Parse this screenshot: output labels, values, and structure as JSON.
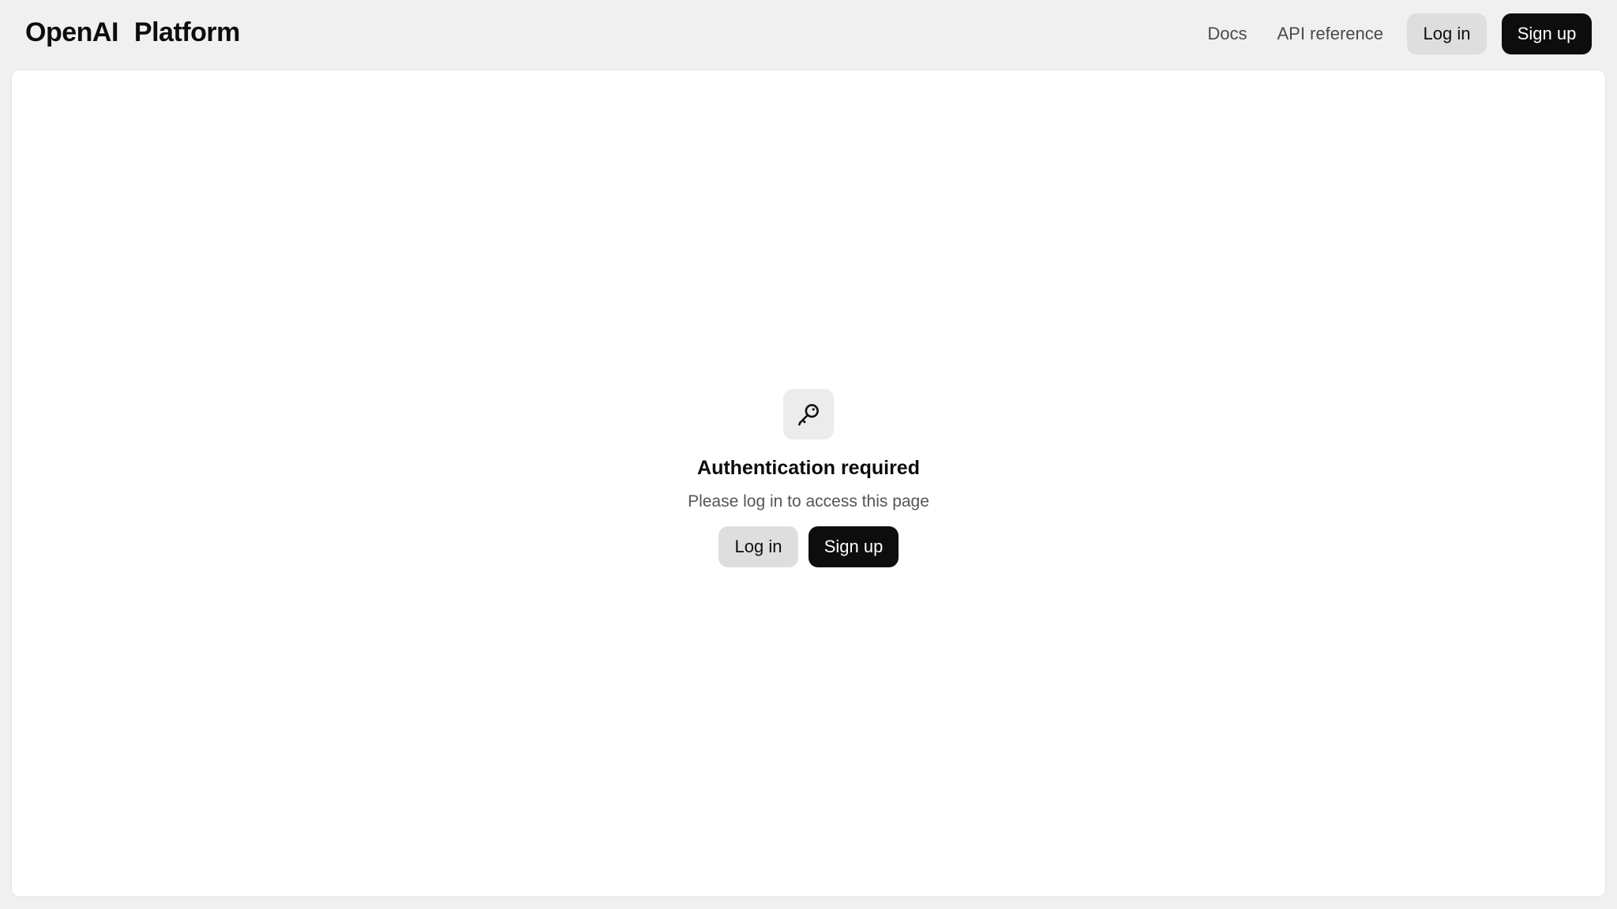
{
  "header": {
    "brand_primary": "OpenAI",
    "brand_secondary": "Platform",
    "nav": {
      "docs": "Docs",
      "api_reference": "API reference"
    },
    "login_label": "Log in",
    "signup_label": "Sign up"
  },
  "main": {
    "icon": "key-icon",
    "title": "Authentication required",
    "subtitle": "Please log in to access this page",
    "login_label": "Log in",
    "signup_label": "Sign up"
  },
  "colors": {
    "background": "#f0f0f0",
    "card": "#ffffff",
    "primary_button": "#0d0d0d",
    "secondary_button": "#dedede"
  }
}
